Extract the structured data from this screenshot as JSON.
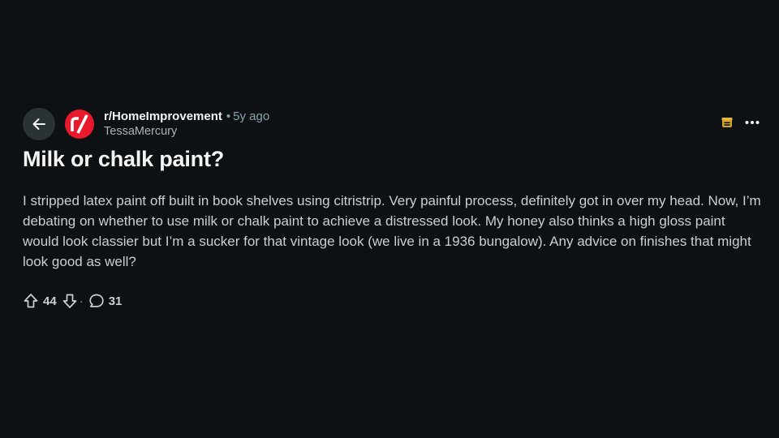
{
  "post": {
    "subreddit": "r/HomeImprovement",
    "separator": "•",
    "age": "5y ago",
    "author": "TessaMercury",
    "title": "Milk or chalk paint?",
    "body": "I stripped latex paint off built in book shelves using citristrip. Very painful process, definitely got in over my head. Now, I’m debating on whether to use milk or chalk paint to achieve a distressed look. My honey also thinks a high gloss paint would look classier but I’m a sucker for that vintage look (we live in a 1936 bungalow). Any advice on finishes that might look good as well?",
    "avatar_text": "r/",
    "avatar_color": "#e8192c",
    "award_color": "#d4a22a"
  },
  "actions": {
    "upvotes": "44",
    "dot": "·",
    "comments": "31"
  },
  "icons": {
    "back": "arrow-left-icon",
    "award": "award-icon",
    "more": "more-horizontal-icon",
    "upvote": "upvote-arrow-icon",
    "downvote": "downvote-arrow-icon",
    "comment": "comment-bubble-icon"
  }
}
